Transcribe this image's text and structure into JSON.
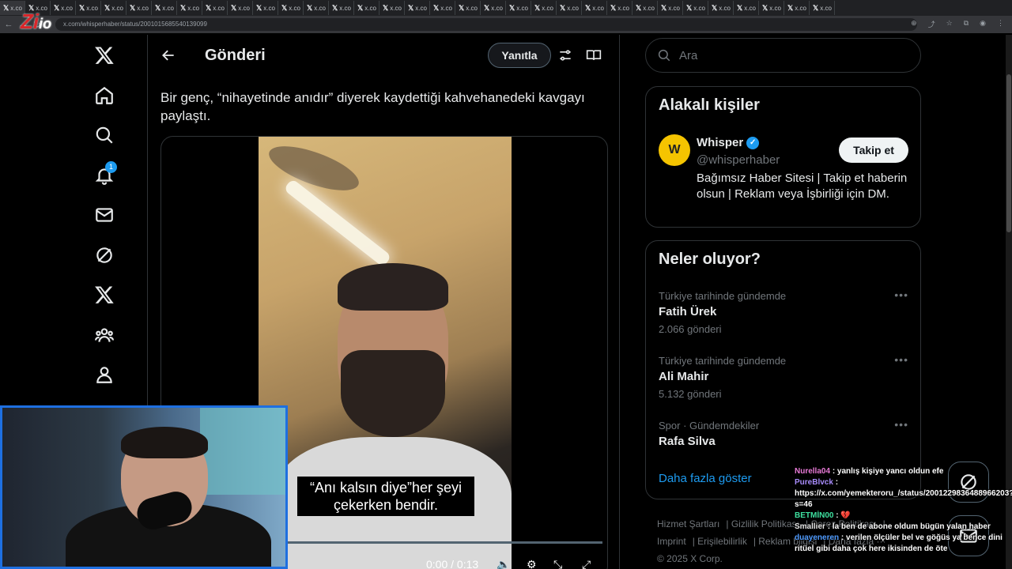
{
  "browser": {
    "tab_label": "x.co",
    "tab_count": 33,
    "url": "x.com/whisperhaber/status/2001015685540139099"
  },
  "overlay_logo": {
    "text": "Zi",
    "suffix": "io"
  },
  "nav": {
    "notifications_badge": "1"
  },
  "header": {
    "title": "Gönderi",
    "reply_label": "Yanıtla"
  },
  "tweet": {
    "text": "Bir genç, “nihayetinde anıdır” diyerek kaydettiği kahvehanedeki kavgayı paylaştı.",
    "video": {
      "subtitle": "“Anı kalsın diye”her şeyi çekerken bendir.",
      "time": "0:00 / 0:13",
      "progress": 0
    }
  },
  "search": {
    "placeholder": "Ara"
  },
  "relevant": {
    "title": "Alakalı kişiler",
    "account": {
      "name": "Whisper",
      "handle": "@whisperhaber",
      "bio": "Bağımsız Haber Sitesi | Takip et haberin olsun | Reklam veya İşbirliği için DM.",
      "follow_label": "Takip et"
    }
  },
  "trends": {
    "title": "Neler oluyor?",
    "items": [
      {
        "context": "Türkiye tarihinde gündemde",
        "name": "Fatih Ürek",
        "count": "2.066 gönderi"
      },
      {
        "context": "Türkiye tarihinde gündemde",
        "name": "Ali Mahir",
        "count": "5.132 gönderi"
      },
      {
        "context": "Spor · Gündemdekiler",
        "name": "Rafa Silva",
        "count": ""
      }
    ],
    "show_more": "Daha fazla göster"
  },
  "footer": {
    "links": [
      "Hizmet Şartları",
      "Gizlilik Politikası",
      "Çerez Politikası",
      "Imprint",
      "Erişilebilirlik",
      "Reklam bilgisi",
      "Daha fazla ···"
    ],
    "copyright": "© 2025 X Corp."
  },
  "chat": [
    {
      "user": "Nurella04",
      "msg": ": yanlış kişiye yancı oldun efe"
    },
    {
      "user": "PureBlvck",
      "msg": ": https://x.com/yemekteroru_/status/2001229836488966203?s=46"
    },
    {
      "user": "BETMİN00",
      "msg": ": 💔"
    },
    {
      "user": "Smallier",
      "msg": ": la ben de abone oldum bügün yalan haber"
    },
    {
      "user": "duayeneren",
      "msg": ": verilen ölçüler bel ve göğüs ya bence dini ritüel gibi daha çok here ikisinden de öte"
    }
  ],
  "colors": {
    "accent": "#1d9bf0",
    "webcam_border": "#1e6fe0",
    "background": "#000000"
  }
}
